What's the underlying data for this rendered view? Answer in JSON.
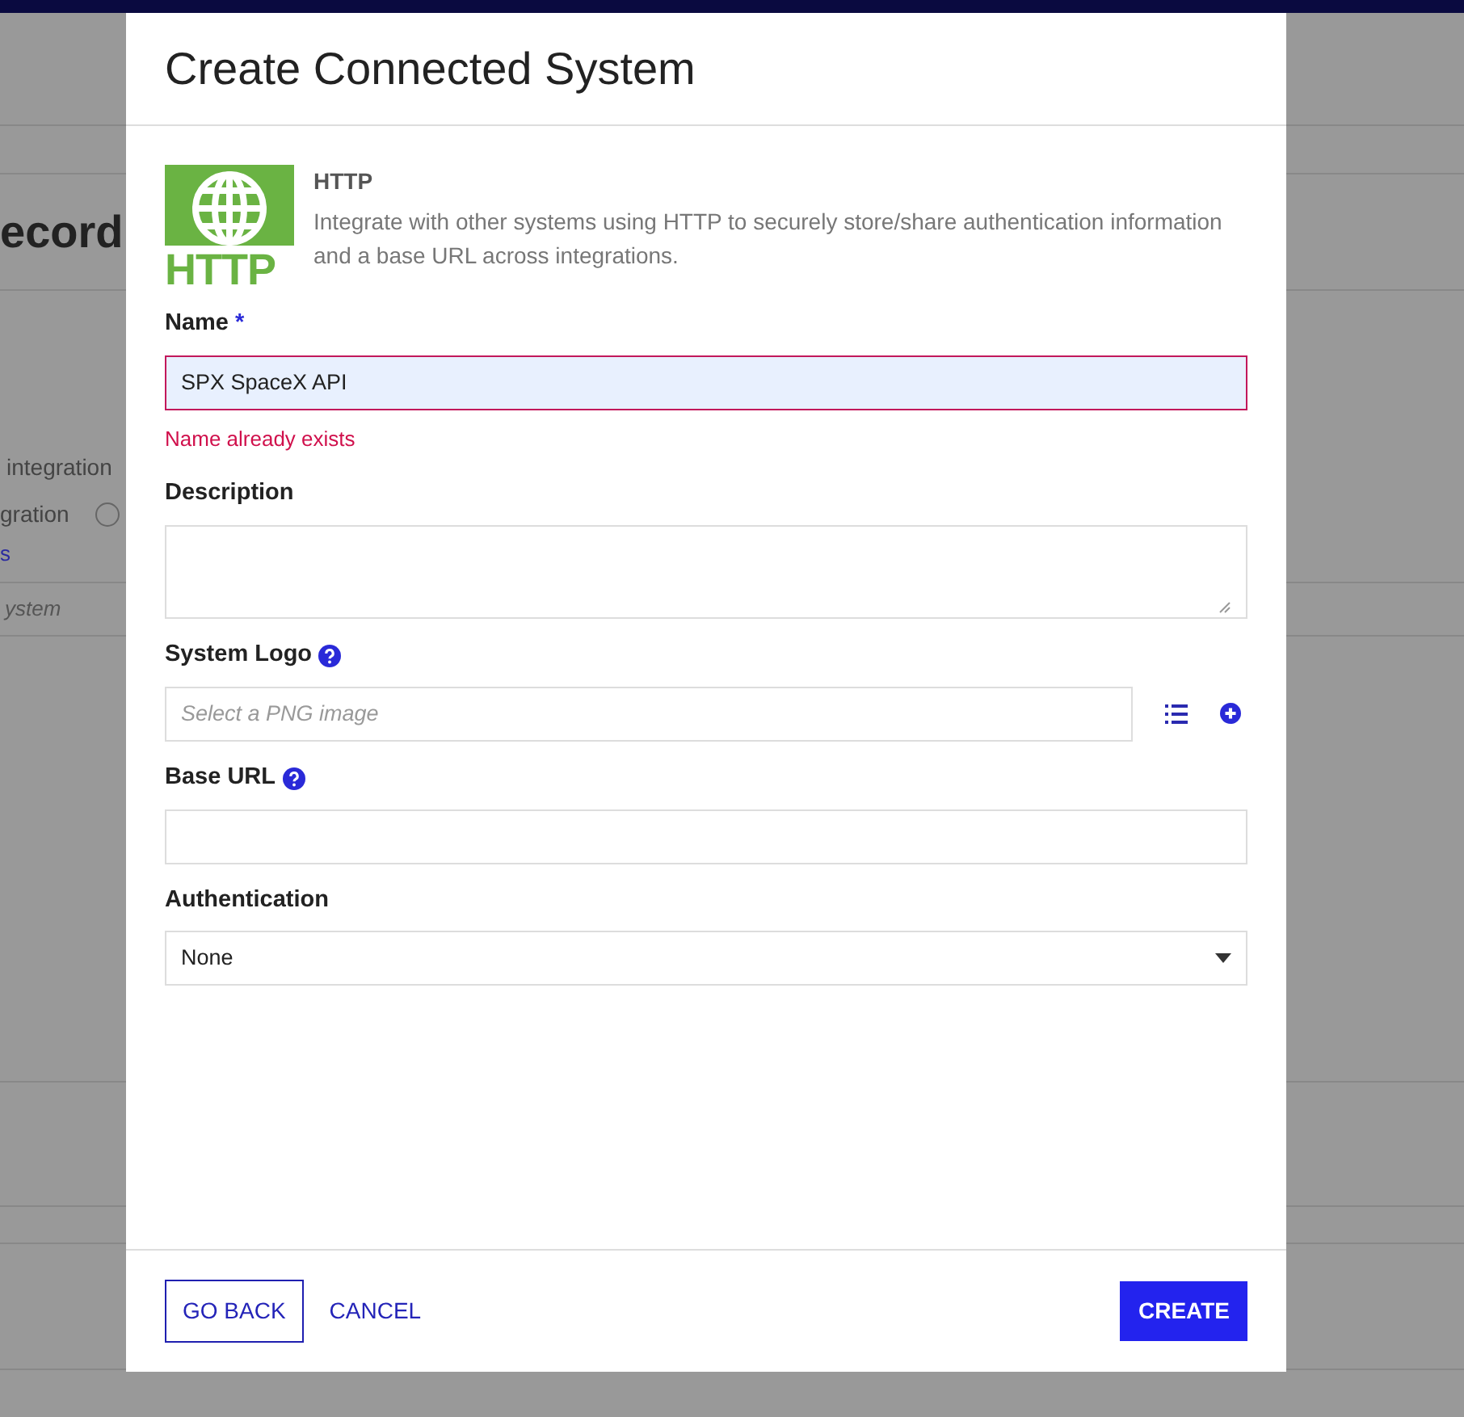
{
  "background": {
    "heading": "ecord",
    "items": [
      {
        "kind": "text",
        "text": "integration"
      },
      {
        "kind": "radio",
        "text": "gration",
        "checked": false
      },
      {
        "kind": "link",
        "text": "s"
      },
      {
        "kind": "placeholder",
        "text": "ystem"
      }
    ]
  },
  "dialog": {
    "title": "Create Connected System",
    "connector": {
      "name": "HTTP",
      "logo_text": "HTTP",
      "description": "Integrate with other systems using HTTP to securely store/share authentication information and a base URL across integrations."
    },
    "fields": [
      {
        "kind": "text",
        "label": "Name",
        "required_mark": "*",
        "value": "SPX SpaceX API",
        "error": "Name already exists"
      },
      {
        "kind": "textarea",
        "label": "Description"
      },
      {
        "kind": "picker",
        "label": "System Logo",
        "help": true,
        "placeholder": "Select a PNG image"
      },
      {
        "kind": "text",
        "label": "Base URL",
        "help": true
      },
      {
        "kind": "select",
        "label": "Authentication",
        "value": "None"
      }
    ],
    "buttons": [
      {
        "kind": "outline",
        "label": "GO BACK"
      },
      {
        "kind": "link",
        "label": "CANCEL"
      },
      {
        "kind": "primary",
        "label": "CREATE"
      }
    ]
  }
}
